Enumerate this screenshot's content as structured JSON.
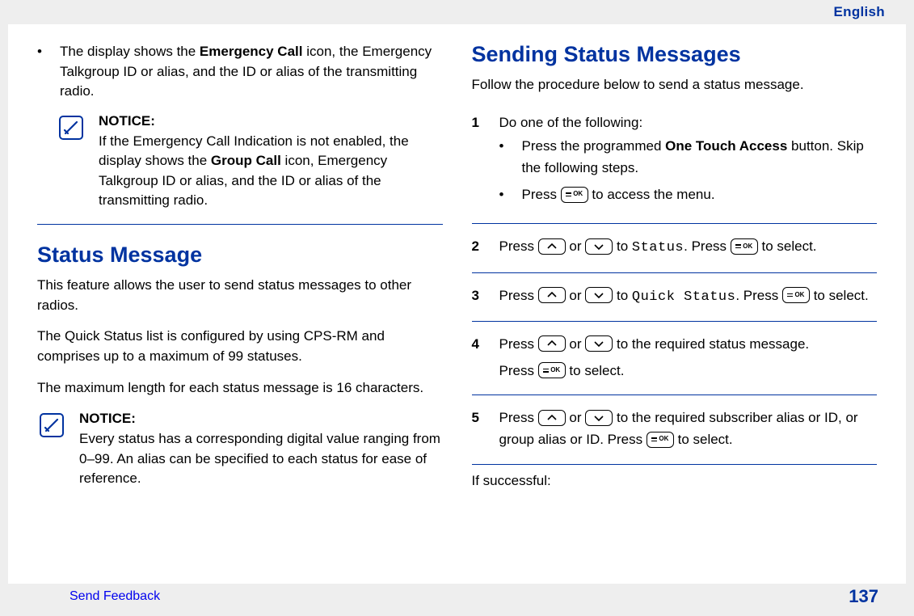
{
  "header": {
    "language": "English"
  },
  "left": {
    "bullet": {
      "pre": "The display shows the ",
      "bold1": "Emergency Call",
      "post": " icon, the Emergency Talkgroup ID or alias, and the ID or alias of the transmitting radio."
    },
    "notice1": {
      "title": "NOTICE:",
      "pre": "If the Emergency Call Indication is not enabled, the display shows the ",
      "bold": "Group Call",
      "post": " icon, Emergency Talkgroup ID or alias, and the ID or alias of the transmitting radio."
    },
    "h1": "Status Message",
    "p1": "This feature allows the user to send status messages to other radios.",
    "p2": "The Quick Status list is configured by using CPS-RM and comprises up to a maximum of 99 statuses.",
    "p3": "The maximum length for each status message is 16 characters.",
    "notice2": {
      "title": "NOTICE:",
      "body": "Every status has a corresponding digital value ranging from 0–99. An alias can be specified to each status for ease of reference."
    }
  },
  "right": {
    "h1": "Sending Status Messages",
    "intro": "Follow the procedure below to send a status message.",
    "step1": {
      "num": "1",
      "lead": "Do one of the following:",
      "opt1_pre": "Press the programmed ",
      "opt1_bold": "One Touch Access",
      "opt1_post": " button. Skip the following steps.",
      "opt2_pre": "Press ",
      "opt2_post": " to access the menu."
    },
    "step2": {
      "num": "2",
      "pre": "Press ",
      "mid": " or ",
      "to": " to ",
      "mono": "Status",
      "afterMono": ". Press ",
      "end": " to select."
    },
    "step3": {
      "num": "3",
      "pre": "Press ",
      "mid": " or ",
      "to": " to ",
      "mono": "Quick Status",
      "afterMono": ". Press ",
      "end": " to select."
    },
    "step4": {
      "num": "4",
      "line1a": "Press ",
      "line1b": " or ",
      "line1c": " to the required status message.",
      "line2a": "Press ",
      "line2b": " to select."
    },
    "step5": {
      "num": "5",
      "a": "Press ",
      "b": " or ",
      "c": " to the required subscriber alias or ID, or group alias or ID. Press ",
      "d": " to select."
    },
    "tail": "If successful:"
  },
  "footer": {
    "feedback": "Send Feedback",
    "page": "137"
  },
  "labels": {
    "ok": "OK"
  }
}
